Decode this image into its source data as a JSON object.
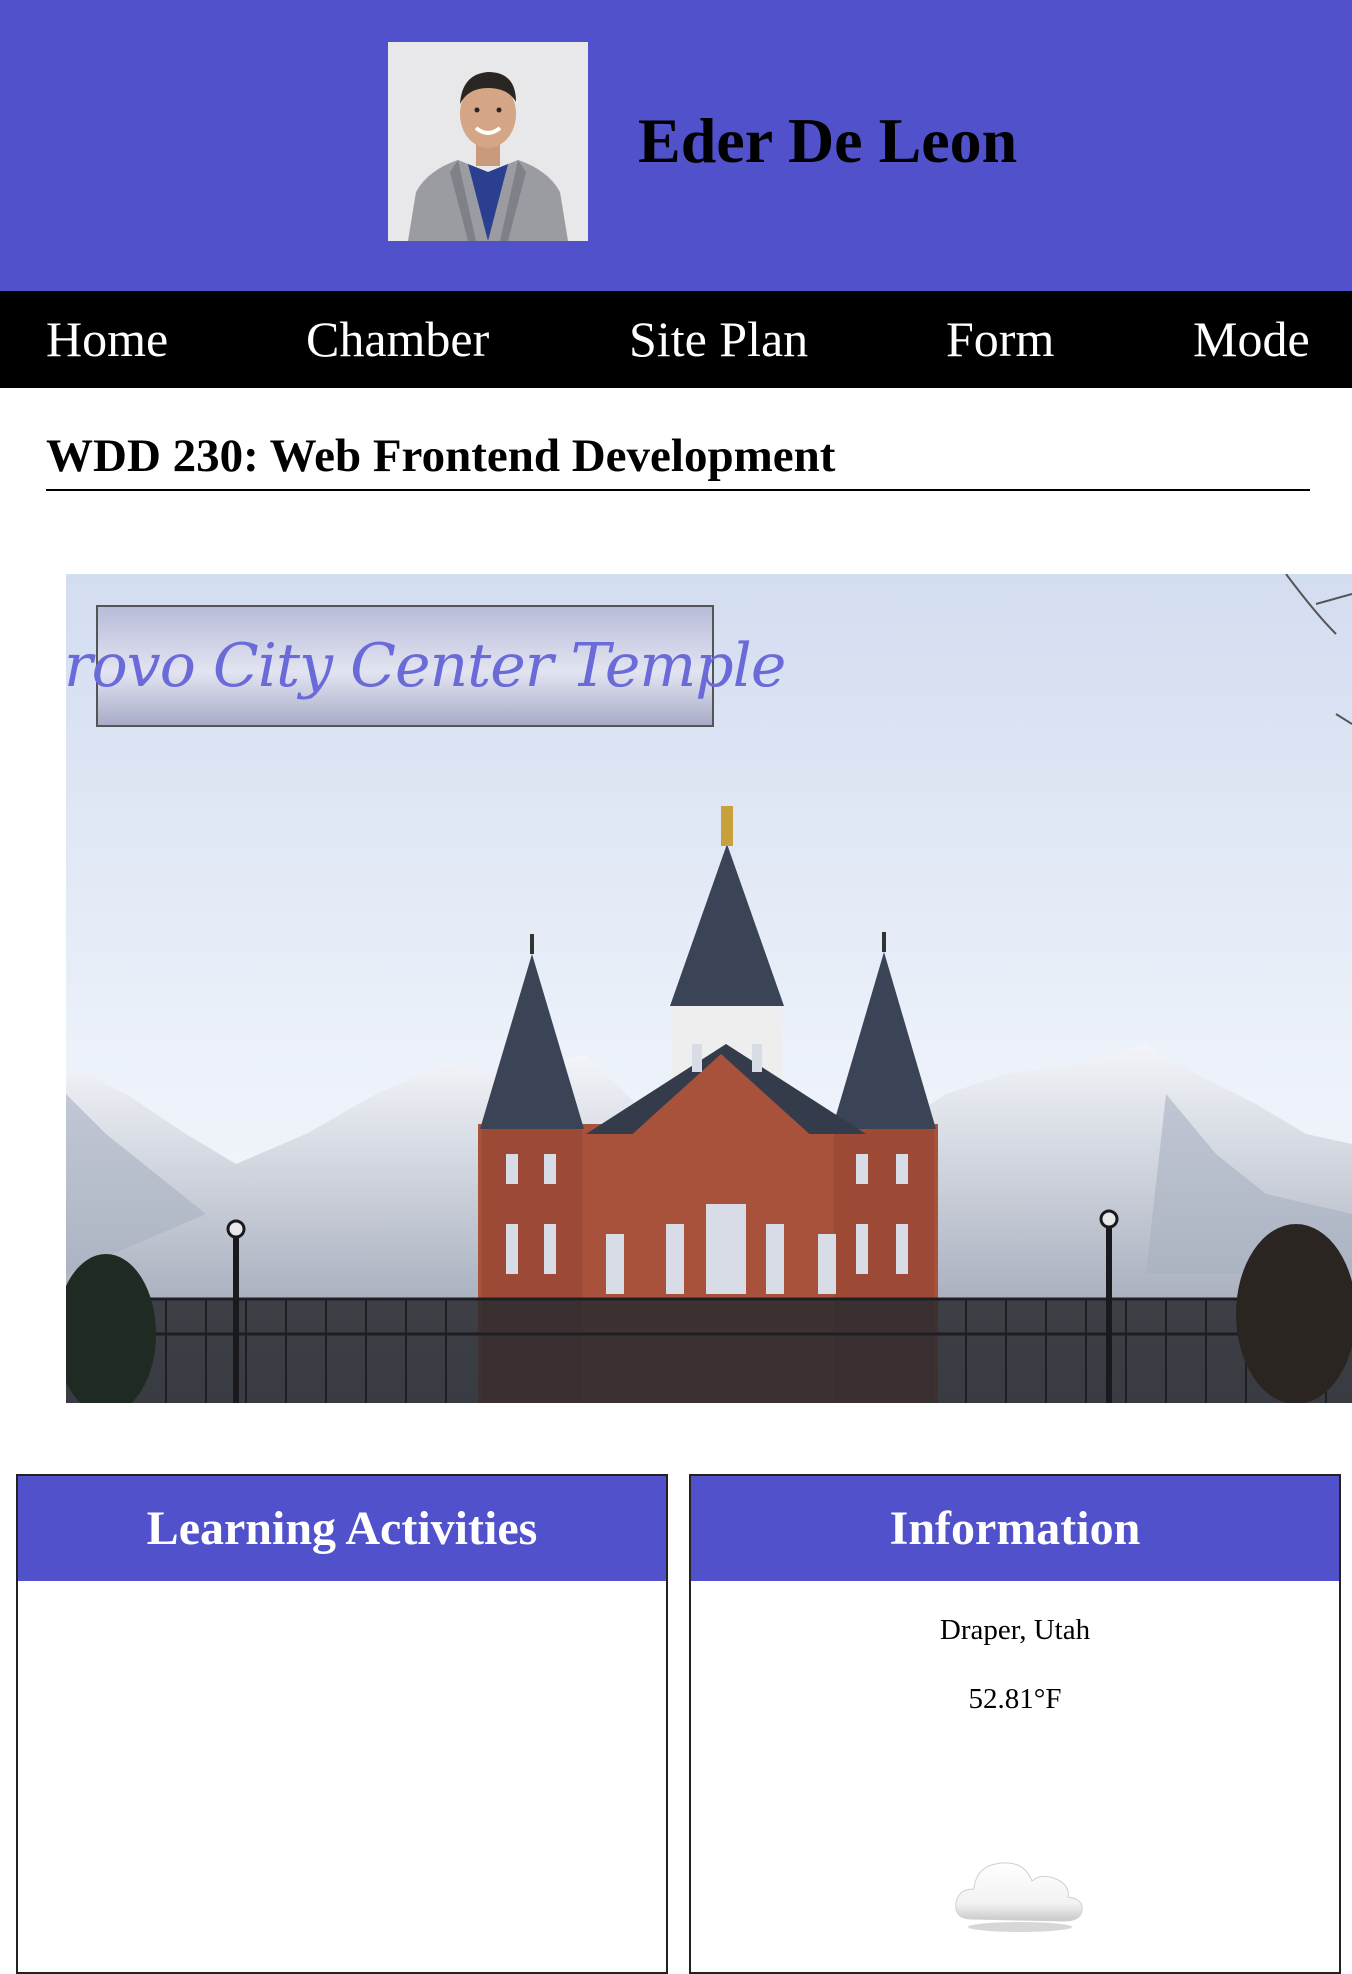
{
  "header": {
    "name": "Eder De Leon",
    "avatar_alt": "profile-photo"
  },
  "nav": {
    "items": [
      "Home",
      "Chamber",
      "Site Plan",
      "Form",
      "Mode"
    ]
  },
  "main": {
    "course_title": "WDD 230: Web Frontend Development",
    "hero_banner": "Provo City Center Temple"
  },
  "cards": {
    "learning": {
      "title": "Learning Activities"
    },
    "information": {
      "title": "Information",
      "location": "Draper, Utah",
      "temperature": "52.81°F",
      "weather_icon": "cloud-icon"
    }
  },
  "colors": {
    "accent": "#5051cb",
    "nav_bg": "#000000"
  }
}
